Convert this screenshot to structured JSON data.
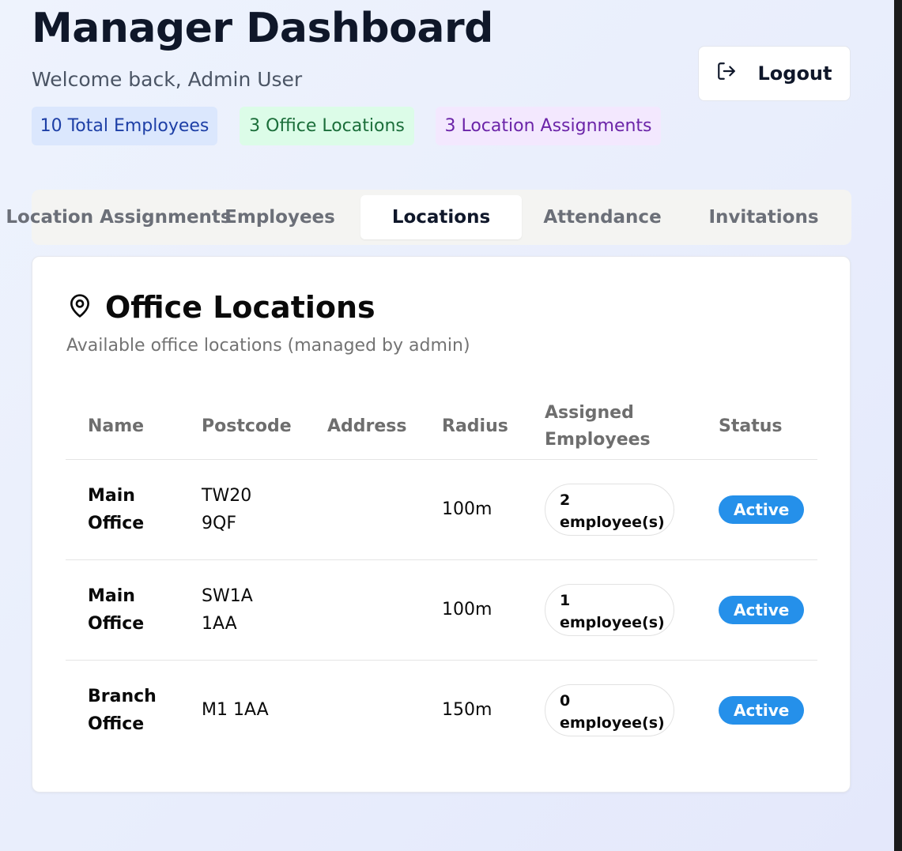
{
  "header": {
    "title": "Manager Dashboard",
    "welcome": "Welcome back, Admin User",
    "logout_label": "Logout"
  },
  "stats": {
    "employees": "10 Total Employees",
    "locations": "3 Office Locations",
    "assignments": "3 Location Assignments"
  },
  "tabs": [
    {
      "label": "Location Assignments"
    },
    {
      "label": "Employees"
    },
    {
      "label": "Locations",
      "active": true
    },
    {
      "label": "Attendance"
    },
    {
      "label": "Invitations"
    }
  ],
  "card": {
    "title": "Office Locations",
    "subtitle": "Available office locations (managed by admin)"
  },
  "table": {
    "headers": {
      "name": "Name",
      "postcode": "Postcode",
      "address": "Address",
      "radius": "Radius",
      "assigned_line1": "Assigned",
      "assigned_line2": "Employees",
      "status": "Status"
    },
    "rows": [
      {
        "name_line1": "Main",
        "name_line2": "Office",
        "postcode_line1": "TW20",
        "postcode_line2": "9QF",
        "address": "",
        "radius": "100m",
        "assigned_count": "2",
        "assigned_label": "employee(s)",
        "status": "Active"
      },
      {
        "name_line1": "Main",
        "name_line2": "Office",
        "postcode_line1": "SW1A",
        "postcode_line2": "1AA",
        "address": "",
        "radius": "100m",
        "assigned_count": "1",
        "assigned_label": "employee(s)",
        "status": "Active"
      },
      {
        "name_line1": "Branch",
        "name_line2": "Office",
        "postcode_line1": "M1 1AA",
        "postcode_line2": "",
        "address": "",
        "radius": "150m",
        "assigned_count": "0",
        "assigned_label": "employee(s)",
        "status": "Active"
      }
    ]
  },
  "colors": {
    "accent_status": "#2590ea",
    "badge_blue_bg": "#dbe7fd",
    "badge_green_bg": "#dcfce8",
    "badge_purple_bg": "#f3e8fe"
  },
  "icons": {
    "logout": "logout-icon",
    "location": "map-pin-icon"
  }
}
